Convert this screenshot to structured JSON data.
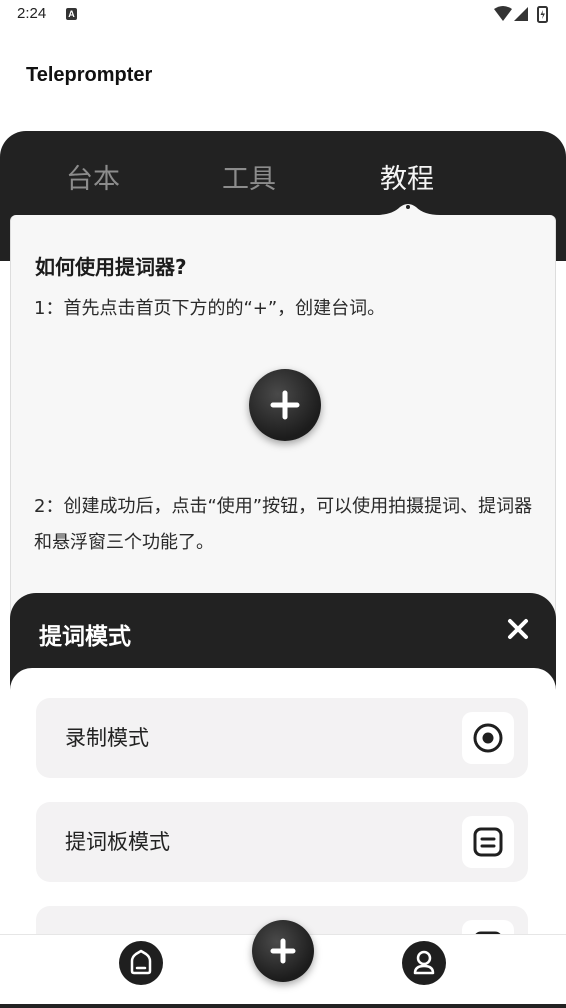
{
  "status_bar": {
    "time": "2:24",
    "notification_badge": "A"
  },
  "app": {
    "title": "Teleprompter"
  },
  "tabs": [
    {
      "label": "台本",
      "active": false
    },
    {
      "label": "工具",
      "active": false
    },
    {
      "label": "教程",
      "active": true
    }
  ],
  "tutorial": {
    "title": "如何使用提词器?",
    "step1": "1：首先点击首页下方的的“+”，创建台词。",
    "step2": "2：创建成功后，点击“使用”按钮，可以使用拍摄提词、提词器和悬浮窗三个功能了。"
  },
  "sheet": {
    "title": "提词模式",
    "items": [
      {
        "label": "录制模式",
        "icon": "record-icon"
      },
      {
        "label": "提词板模式",
        "icon": "board-icon"
      },
      {
        "label": "",
        "icon": "window-icon"
      }
    ]
  },
  "nav": {
    "home_icon": "home-icon",
    "add_icon": "plus-icon",
    "profile_icon": "user-icon"
  },
  "colors": {
    "dark": "#222222",
    "card": "#f7f7f7",
    "item": "#f3f2f3"
  }
}
